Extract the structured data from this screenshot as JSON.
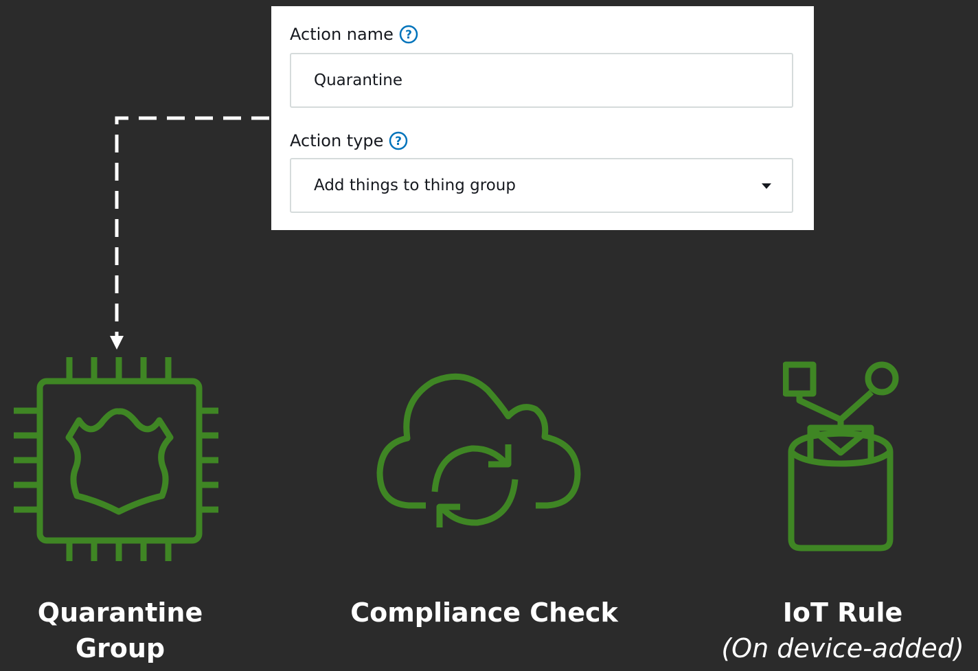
{
  "form": {
    "action_name_label": "Action name",
    "action_name_value": "Quarantine",
    "action_type_label": "Action type",
    "action_type_value": "Add things to thing group",
    "help_icon": "question-circle-icon",
    "dropdown_icon": "caret-down-icon"
  },
  "icons": {
    "quarantine": "chip-shield-icon",
    "compliance": "cloud-sync-icon",
    "iot_rule": "topic-rule-bucket-icon",
    "connector": "dashed-arrow-connector"
  },
  "labels": {
    "quarantine_line1": "Quarantine",
    "quarantine_line2": "Group",
    "compliance": "Compliance Check",
    "iot_rule_line1": "IoT Rule",
    "iot_rule_line2": "(On device-added)"
  },
  "colors": {
    "background": "#2b2b2b",
    "icon_green": "#3f8624",
    "help_blue": "#0073bb",
    "text_white": "#ffffff"
  }
}
